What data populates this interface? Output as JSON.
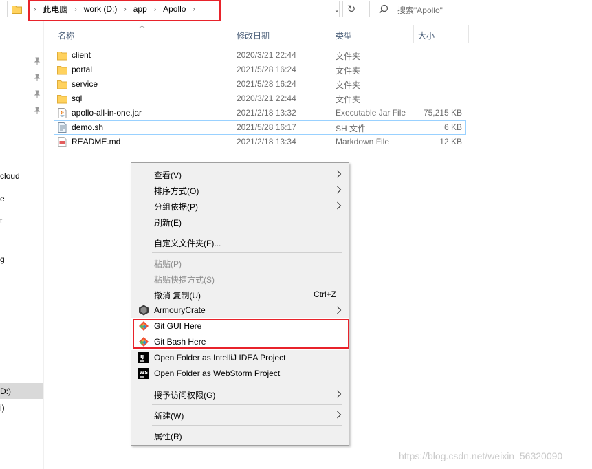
{
  "address_bar": {
    "crumbs": [
      "此电脑",
      "work (D:)",
      "app",
      "Apollo"
    ],
    "separator": "›",
    "dropdown": "⌄",
    "refresh": "↻"
  },
  "search": {
    "placeholder": "搜索\"Apollo\""
  },
  "nav_fragments": [
    "cloud",
    "e",
    "t",
    "g",
    "D:)",
    "i)"
  ],
  "columns": {
    "name": "名称",
    "date": "修改日期",
    "type": "类型",
    "size": "大小"
  },
  "files": [
    {
      "name": "client",
      "date": "2020/3/21 22:44",
      "type": "文件夹",
      "size": "",
      "icon": "folder-icon"
    },
    {
      "name": "portal",
      "date": "2021/5/28 16:24",
      "type": "文件夹",
      "size": "",
      "icon": "folder-icon"
    },
    {
      "name": "service",
      "date": "2021/5/28 16:24",
      "type": "文件夹",
      "size": "",
      "icon": "folder-icon"
    },
    {
      "name": "sql",
      "date": "2020/3/21 22:44",
      "type": "文件夹",
      "size": "",
      "icon": "folder-icon"
    },
    {
      "name": "apollo-all-in-one.jar",
      "date": "2021/2/18 13:32",
      "type": "Executable Jar File",
      "size": "75,215 KB",
      "icon": "jar-icon"
    },
    {
      "name": "demo.sh",
      "date": "2021/5/28 16:17",
      "type": "SH 文件",
      "size": "6 KB",
      "icon": "shell-file-icon"
    },
    {
      "name": "README.md",
      "date": "2021/2/18 13:34",
      "type": "Markdown File",
      "size": "12 KB",
      "icon": "markdown-file-icon"
    }
  ],
  "context_menu": {
    "view": "查看(V)",
    "sort_by": "排序方式(O)",
    "group_by": "分组依据(P)",
    "refresh": "刷新(E)",
    "customize_folder": "自定义文件夹(F)...",
    "paste": "粘贴(P)",
    "paste_shortcut": "粘贴快捷方式(S)",
    "undo_copy": "撤消 复制(U)",
    "undo_copy_shortcut": "Ctrl+Z",
    "armoury_crate": "ArmouryCrate",
    "git_gui": "Git GUI Here",
    "git_bash": "Git Bash Here",
    "open_intellij": "Open Folder as IntelliJ IDEA Project",
    "open_webstorm": "Open Folder as WebStorm Project",
    "give_access": "授予访问权限(G)",
    "new": "新建(W)",
    "properties": "属性(R)",
    "intellij_badge": "IJ",
    "webstorm_badge": "WS"
  },
  "watermark": "https://blog.csdn.net/weixin_56320090",
  "colors": {
    "highlight_red": "#e8232b",
    "selection_border": "#99d1ff",
    "folder_yellow": "#ffd25e",
    "menu_bg": "#f0f0f0"
  }
}
